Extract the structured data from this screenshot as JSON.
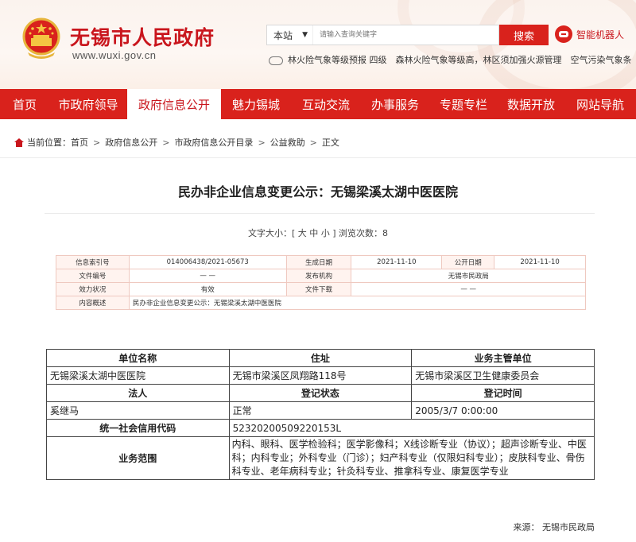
{
  "header": {
    "site_title": "无锡市人民政府",
    "site_url": "www.wuxi.gov.cn",
    "search": {
      "scope": "本站",
      "placeholder": "请输入查询关键字",
      "button": "搜索"
    },
    "robot_label": "智能机器人",
    "weather_ticker": "林火险气象等级预报 四级　森林火险气象等级高，林区须加强火源管理　空气污染气象条"
  },
  "nav": [
    {
      "label": "首页"
    },
    {
      "label": "市政府领导"
    },
    {
      "label": "政府信息公开",
      "active": true
    },
    {
      "label": "魅力锡城"
    },
    {
      "label": "互动交流"
    },
    {
      "label": "办事服务"
    },
    {
      "label": "专题专栏"
    },
    {
      "label": "数据开放"
    },
    {
      "label": "网站导航"
    }
  ],
  "breadcrumb": {
    "prefix": "当前位置：",
    "items": [
      "首页",
      "政府信息公开",
      "市政府信息公开目录",
      "公益救助",
      "正文"
    ]
  },
  "article": {
    "title": "民办非企业信息变更公示：无锡梁溪太湖中医医院",
    "meta": "文字大小：[ 大 中 小 ]  浏览次数：8"
  },
  "info_table": {
    "index_label": "信息索引号",
    "index_value": "014006438/2021-05673",
    "gen_date_label": "生成日期",
    "gen_date_value": "2021-11-10",
    "pub_date_label": "公开日期",
    "pub_date_value": "2021-11-10",
    "doc_no_label": "文件编号",
    "doc_no_value": "— —",
    "publisher_label": "发布机构",
    "publisher_value": "无锡市民政局",
    "status_label": "效力状况",
    "status_value": "有效",
    "download_label": "文件下载",
    "download_value": "— —",
    "summary_label": "内容概述",
    "summary_value": "民办非企业信息变更公示：无锡梁溪太湖中医医院"
  },
  "org_table": {
    "h_name": "单位名称",
    "h_address": "住址",
    "h_authority": "业务主管单位",
    "name": "无锡梁溪太湖中医医院",
    "address": "无锡市梁溪区凤翔路118号",
    "authority": "无锡市梁溪区卫生健康委员会",
    "h_legal": "法人",
    "h_reg_status": "登记状态",
    "h_reg_time": "登记时间",
    "legal": "奚继马",
    "reg_status": "正常",
    "reg_time": "2005/3/7 0:00:00",
    "h_credit_code": "统一社会信用代码",
    "credit_code": "52320200509220153L",
    "h_scope": "业务范围",
    "scope": "内科、眼科、医学检验科；医学影像科；X线诊断专业（协议）；超声诊断专业、中医科；内科专业；外科专业（门诊）；妇产科专业（仅限妇科专业）；皮肤科专业、骨伤科专业、老年病科专业；针灸科专业、推拿科专业、康复医学专业"
  },
  "source": "来源：  无锡市民政局",
  "colors": {
    "brand_red": "#d9221c",
    "title_red": "#c9161d"
  }
}
